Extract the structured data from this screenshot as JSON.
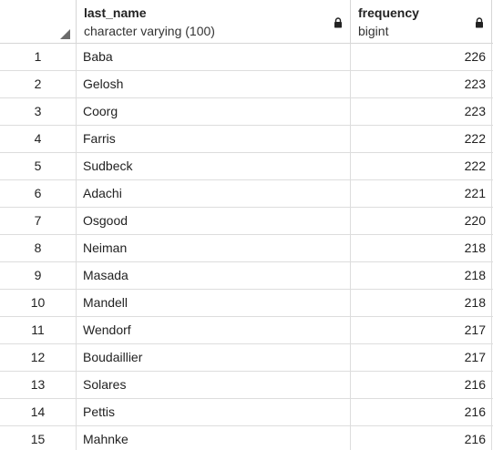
{
  "columns": [
    {
      "name": "last_name",
      "type": "character varying (100)"
    },
    {
      "name": "frequency",
      "type": "bigint"
    }
  ],
  "rows": [
    {
      "n": "1",
      "last_name": "Baba",
      "frequency": "226"
    },
    {
      "n": "2",
      "last_name": "Gelosh",
      "frequency": "223"
    },
    {
      "n": "3",
      "last_name": "Coorg",
      "frequency": "223"
    },
    {
      "n": "4",
      "last_name": "Farris",
      "frequency": "222"
    },
    {
      "n": "5",
      "last_name": "Sudbeck",
      "frequency": "222"
    },
    {
      "n": "6",
      "last_name": "Adachi",
      "frequency": "221"
    },
    {
      "n": "7",
      "last_name": "Osgood",
      "frequency": "220"
    },
    {
      "n": "8",
      "last_name": "Neiman",
      "frequency": "218"
    },
    {
      "n": "9",
      "last_name": "Masada",
      "frequency": "218"
    },
    {
      "n": "10",
      "last_name": "Mandell",
      "frequency": "218"
    },
    {
      "n": "11",
      "last_name": "Wendorf",
      "frequency": "217"
    },
    {
      "n": "12",
      "last_name": "Boudaillier",
      "frequency": "217"
    },
    {
      "n": "13",
      "last_name": "Solares",
      "frequency": "216"
    },
    {
      "n": "14",
      "last_name": "Pettis",
      "frequency": "216"
    },
    {
      "n": "15",
      "last_name": "Mahnke",
      "frequency": "216"
    }
  ],
  "icons": {
    "column_lock": "lock-icon",
    "select_all": "select-all-corner-icon"
  },
  "colors": {
    "grid_line": "#dddddd",
    "header_bg": "#ffffff",
    "text": "#222222"
  }
}
